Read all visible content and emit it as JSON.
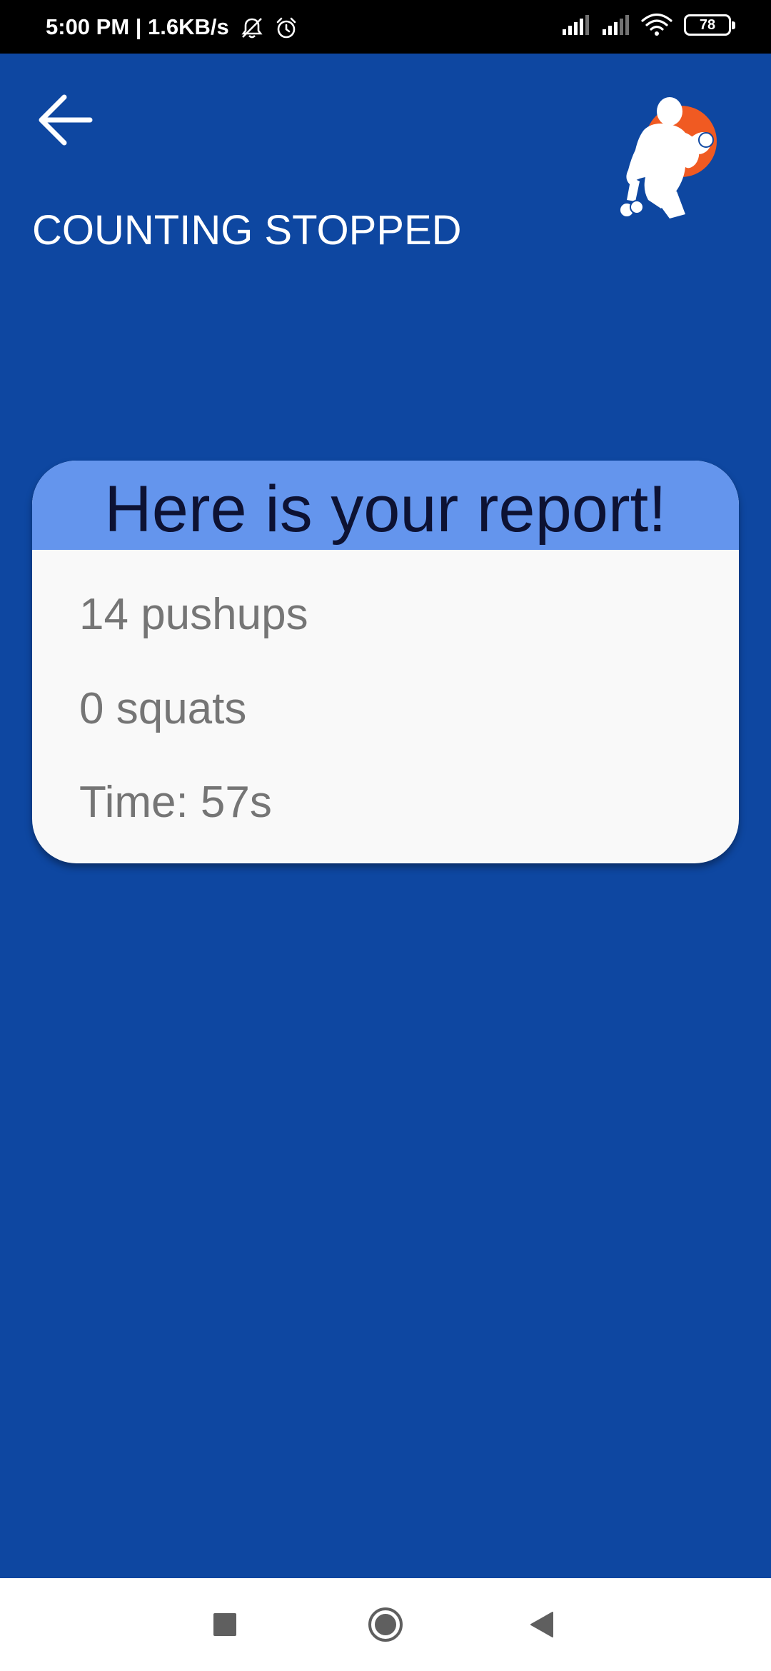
{
  "status_bar": {
    "time_network": "5:00 PM | 1.6KB/s",
    "battery_level": "78",
    "icons": [
      "notifications-muted-icon",
      "alarm-icon",
      "cell-signal-icon",
      "cell-signal-icon",
      "wifi-icon",
      "battery-icon"
    ]
  },
  "header": {
    "back_icon": "arrow-left-icon",
    "title": "COUNTING STOPPED",
    "logo_icon": "bodybuilder-logo-icon"
  },
  "report": {
    "title": "Here is your report!",
    "pushups": "14 pushups",
    "squats": "0 squats",
    "time": "Time: 57s"
  },
  "nav_bar": {
    "buttons": [
      "recents-square-icon",
      "home-circle-icon",
      "back-triangle-icon"
    ]
  },
  "colors": {
    "background": "#0e47a1",
    "card_header": "#6495ed",
    "card_body": "#f9f9f9",
    "report_title_text": "#0d1233",
    "report_text": "#757575",
    "logo_accent": "#f05a22"
  }
}
